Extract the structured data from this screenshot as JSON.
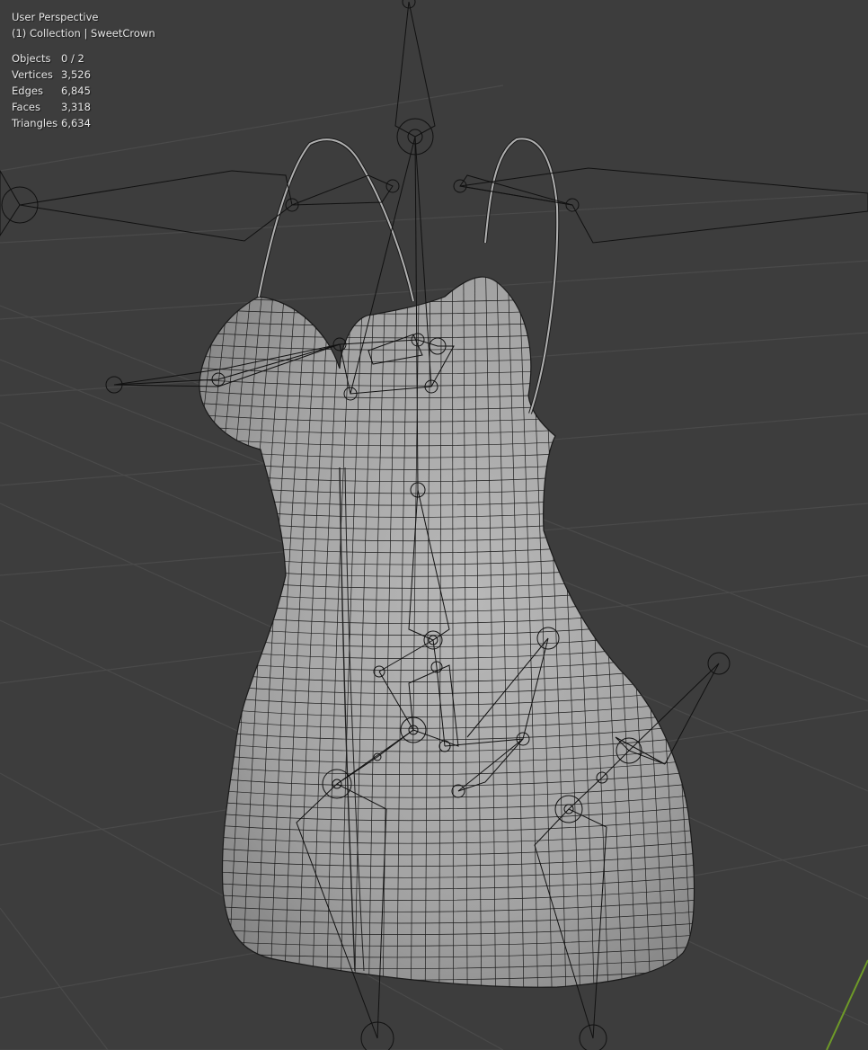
{
  "viewport": {
    "view_name": "User Perspective",
    "collection_line": "(1) Collection | SweetCrown"
  },
  "statistics": [
    {
      "label": "Objects",
      "value": "0 / 2"
    },
    {
      "label": "Vertices",
      "value": "3,526"
    },
    {
      "label": "Edges",
      "value": "6,845"
    },
    {
      "label": "Faces",
      "value": "3,318"
    },
    {
      "label": "Triangles",
      "value": "6,634"
    }
  ],
  "colors": {
    "background": "#3d3d3d",
    "grid": "#4a4a4a",
    "mesh_fill": "#a8a8a8",
    "wire": "#111111",
    "y_axis": "#6e9a28"
  }
}
